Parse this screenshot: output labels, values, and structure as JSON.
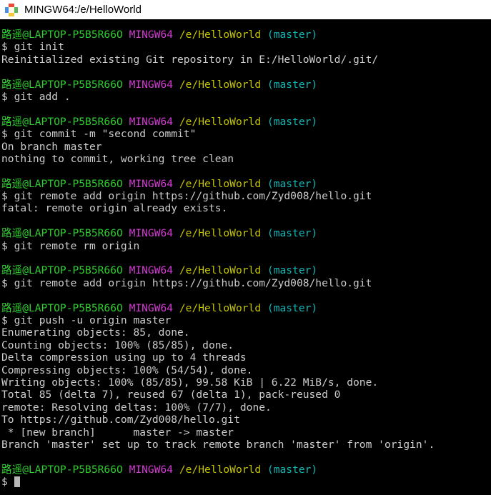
{
  "titlebar": {
    "title": "MINGW64:/e/HelloWorld",
    "icon": "mintty-diamond-icon"
  },
  "terminal": {
    "prompt": {
      "user": "路遥@LAPTOP-P5B5R66O",
      "host": "MINGW64",
      "path": "/e/HelloWorld",
      "branch": "(master)",
      "symbol": "$"
    },
    "colors": {
      "background": "#000000",
      "foreground": "#cccccc",
      "user": "#2ecc2e",
      "host": "#d33bd3",
      "path": "#c2c200",
      "branch": "#12b5b5",
      "titlebar_background": "#ffffff",
      "titlebar_foreground": "#000000"
    },
    "blocks": [
      {
        "command": "$ git init",
        "output": [
          "Reinitialized existing Git repository in E:/HelloWorld/.git/"
        ]
      },
      {
        "command": "$ git add .",
        "output": []
      },
      {
        "command": "$ git commit -m \"second commit\"",
        "output": [
          "On branch master",
          "nothing to commit, working tree clean"
        ]
      },
      {
        "command": "$ git remote add origin https://github.com/Zyd008/hello.git",
        "output": [
          "fatal: remote origin already exists."
        ]
      },
      {
        "command": "$ git remote rm origin",
        "output": []
      },
      {
        "command": "$ git remote add origin https://github.com/Zyd008/hello.git",
        "output": []
      },
      {
        "command": "$ git push -u origin master",
        "output": [
          "Enumerating objects: 85, done.",
          "Counting objects: 100% (85/85), done.",
          "Delta compression using up to 4 threads",
          "Compressing objects: 100% (54/54), done.",
          "Writing objects: 100% (85/85), 99.58 KiB | 6.22 MiB/s, done.",
          "Total 85 (delta 7), reused 67 (delta 1), pack-reused 0",
          "remote: Resolving deltas: 100% (7/7), done.",
          "To https://github.com/Zyd008/hello.git",
          " * [new branch]      master -> master",
          "Branch 'master' set up to track remote branch 'master' from 'origin'."
        ]
      }
    ],
    "final_prompt_symbol": "$"
  }
}
